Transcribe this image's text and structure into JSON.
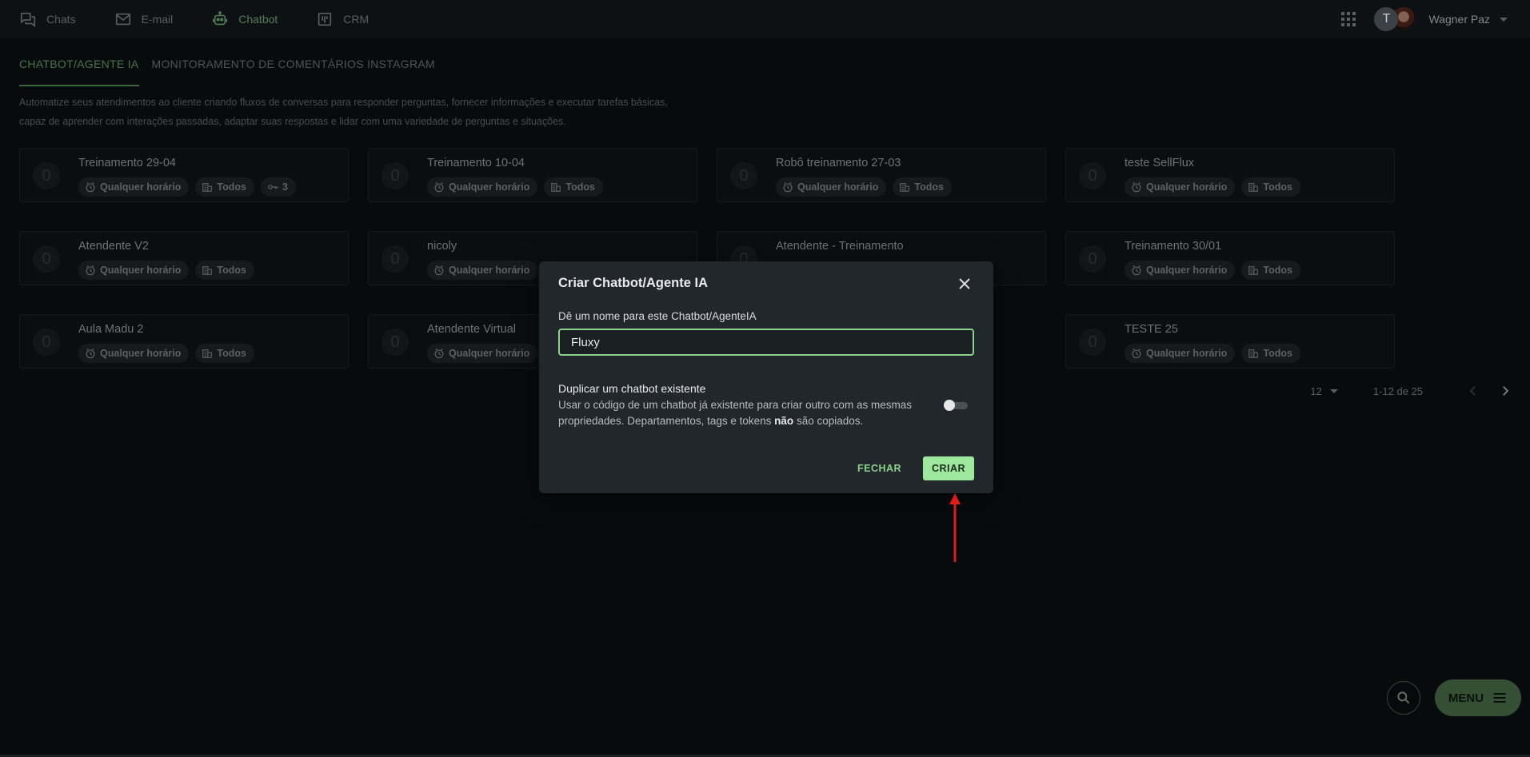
{
  "nav": {
    "items": [
      {
        "label": "Chats",
        "icon": "chats-icon"
      },
      {
        "label": "E-mail",
        "icon": "mail-icon"
      },
      {
        "label": "Chatbot",
        "icon": "robot-icon",
        "active": true
      },
      {
        "label": "CRM",
        "icon": "kanban-icon"
      }
    ],
    "avatar_letter": "T",
    "user_name": "Wagner Paz"
  },
  "tabs": [
    {
      "label": "CHATBOT/AGENTE IA",
      "active": true
    },
    {
      "label": "MONITORAMENTO DE COMENTÁRIOS INSTAGRAM",
      "active": false
    }
  ],
  "description": {
    "line1": "Automatize seus atendimentos ao cliente criando fluxos de conversas para responder perguntas, fornecer informações e executar tarefas básicas,",
    "line2": "capaz de aprender com interações passadas, adaptar suas respostas e lidar com uma variedade de perguntas e situações."
  },
  "cards": [
    {
      "title": "Treinamento 29-04",
      "badge": "0",
      "schedule": "Qualquer horário",
      "dept": "Todos",
      "keys": "3"
    },
    {
      "title": "Treinamento 10-04",
      "badge": "0",
      "schedule": "Qualquer horário",
      "dept": "Todos"
    },
    {
      "title": "Robô treinamento 27-03",
      "badge": "0",
      "schedule": "Qualquer horário",
      "dept": "Todos"
    },
    {
      "title": "teste SellFlux",
      "badge": "0",
      "schedule": "Qualquer horário",
      "dept": "Todos"
    },
    {
      "title": "Atendente V2",
      "badge": "0",
      "schedule": "Qualquer horário",
      "dept": "Todos"
    },
    {
      "title": "nicoly",
      "badge": "0",
      "schedule": "Qualquer horário"
    },
    {
      "title": "Atendente - Treinamento",
      "badge": "0"
    },
    {
      "title": "Treinamento 30/01",
      "badge": "0",
      "schedule": "Qualquer horário",
      "dept": "Todos"
    },
    {
      "title": "Aula Madu 2",
      "badge": "0",
      "schedule": "Qualquer horário",
      "dept": "Todos"
    },
    {
      "title": "Atendente Virtual",
      "badge": "0",
      "schedule": "Qualquer horário"
    },
    {
      "title": "TESTE 25",
      "badge": "0",
      "schedule": "Qualquer horário",
      "dept": "Todos"
    }
  ],
  "pagination": {
    "per_page": "12",
    "range": "1-12 de 25"
  },
  "modal": {
    "title": "Criar Chatbot/Agente IA",
    "name_label": "Dê um nome para este Chatbot/AgenteIA",
    "name_value": "Fluxy",
    "dup_title": "Duplicar um chatbot existente",
    "dup_desc_1": "Usar o código de um chatbot já existente para criar outro com as mesmas propriedades. Departamentos, tags e tokens ",
    "dup_desc_bold": "não",
    "dup_desc_2": " são copiados.",
    "duplicate_enabled": false,
    "close_label": "FECHAR",
    "create_label": "CRIAR"
  },
  "fab": {
    "menu_label": "MENU"
  },
  "colors": {
    "accent": "#7fbf7f",
    "create_button": "#9de89d",
    "annotation_arrow": "#e01b1b",
    "menu_button": "#527a52"
  }
}
